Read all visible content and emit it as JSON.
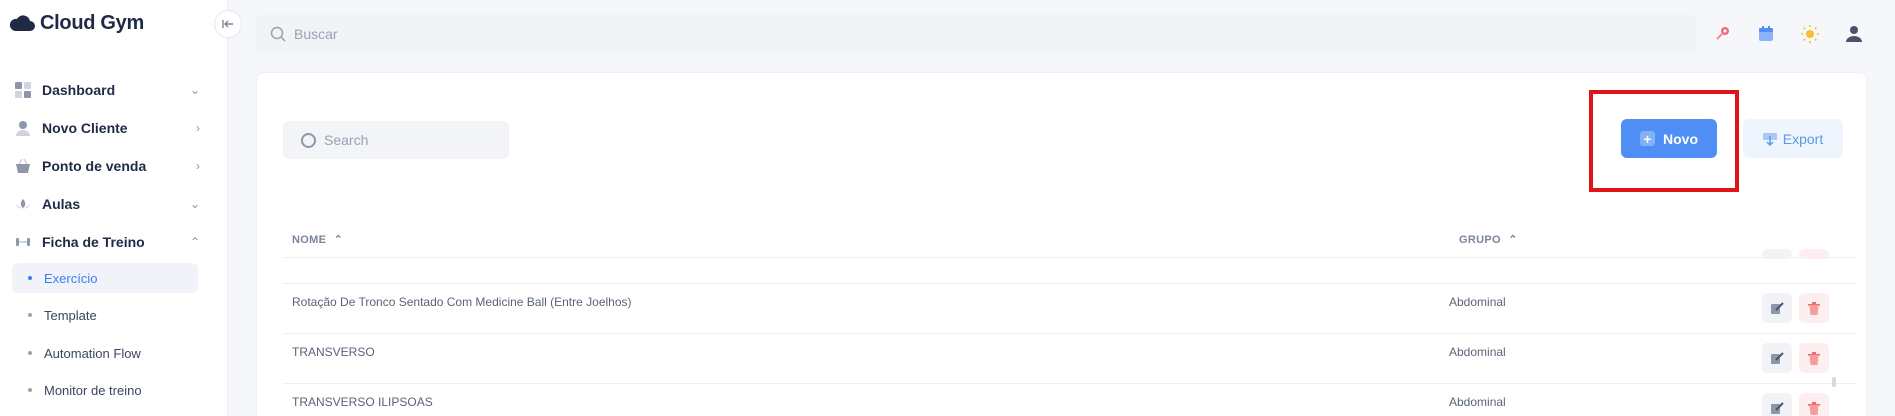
{
  "brand": {
    "name": "Cloud Gym",
    "accent": "#4f8ef5",
    "highlight": "#e0131b"
  },
  "topbar": {
    "search_placeholder": "Buscar",
    "icons": [
      "rocket-icon",
      "calendar-icon",
      "sun-icon",
      "user-icon"
    ]
  },
  "sidebar": {
    "items": [
      {
        "label": "Dashboard",
        "icon": "dashboard-icon",
        "chevron": "⌄"
      },
      {
        "label": "Novo Cliente",
        "icon": "person-icon",
        "chevron": "›"
      },
      {
        "label": "Ponto de venda",
        "icon": "basket-icon",
        "chevron": "›"
      },
      {
        "label": "Aulas",
        "icon": "lotus-icon",
        "chevron": "⌄"
      },
      {
        "label": "Ficha de Treino",
        "icon": "dumbbell-icon",
        "chevron": "⌃"
      }
    ],
    "subitems": [
      {
        "label": "Exercício",
        "active": true
      },
      {
        "label": "Template",
        "active": false
      },
      {
        "label": "Automation Flow",
        "active": false
      },
      {
        "label": "Monitor de treino",
        "active": false
      }
    ]
  },
  "main": {
    "search_placeholder": "Search",
    "novo_label": "Novo",
    "export_label": "Export",
    "columns": {
      "nome": "NOME",
      "grupo": "GRUPO"
    },
    "rows": [
      {
        "nome": "Rotação De Tronco Sentado Com Medicine Ball (Entre Joelhos)",
        "grupo": "Abdominal"
      },
      {
        "nome": "TRANSVERSO",
        "grupo": "Abdominal"
      },
      {
        "nome": "TRANSVERSO ILIPSOAS",
        "grupo": "Abdominal"
      }
    ]
  }
}
